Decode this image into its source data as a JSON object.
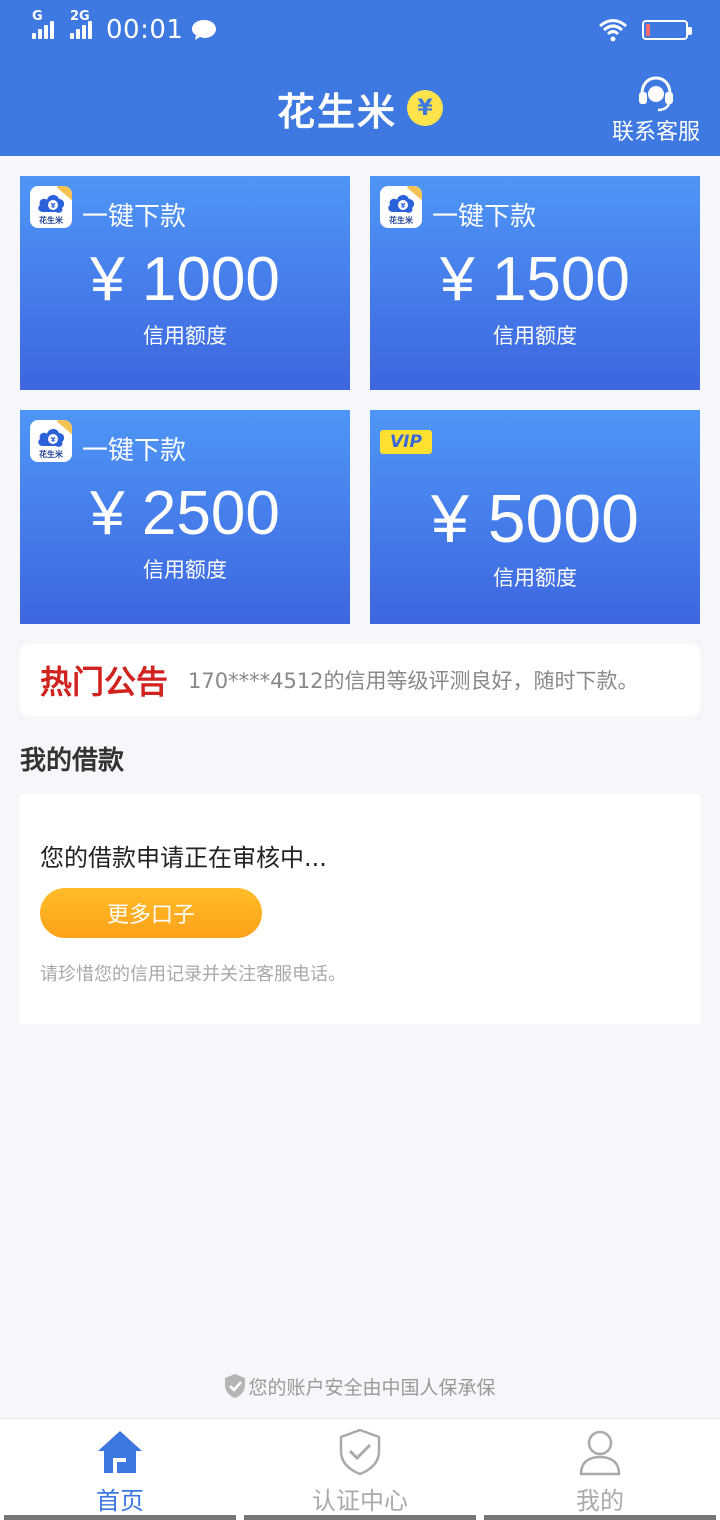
{
  "status_bar": {
    "signal1_label": "G",
    "signal2_label": "2G",
    "time": "00:01",
    "battery_level": "0",
    "battery_fill_fraction": 0.1
  },
  "header": {
    "title": "花生米",
    "coin_symbol": "¥",
    "service_label": "联系客服"
  },
  "cards": [
    {
      "tag": "一键下款",
      "amount": "¥ 1000",
      "sub": "信用额度",
      "logo_caption": "花生米"
    },
    {
      "tag": "一键下款",
      "amount": "¥ 1500",
      "sub": "信用额度",
      "logo_caption": "花生米"
    },
    {
      "tag": "一键下款",
      "amount": "¥ 2500",
      "sub": "信用额度",
      "logo_caption": "花生米"
    },
    {
      "badge": "VIP",
      "amount": "¥ 5000",
      "sub": "信用额度"
    }
  ],
  "notice": {
    "label": "热门公告",
    "text": "170****4512的信用等级评测良好，随时下款。"
  },
  "loan": {
    "section_title": "我的借款",
    "status": "您的借款申请正在审核中...",
    "button": "更多口子",
    "hint": "请珍惜您的信用记录并关注客服电话。"
  },
  "security": {
    "text": "您的账户安全由中国人保承保"
  },
  "nav": [
    {
      "label": "首页"
    },
    {
      "label": "认证中心"
    },
    {
      "label": "我的"
    }
  ],
  "colors": {
    "primary": "#3d79e0",
    "accent_orange": "#ffa11a",
    "notice_red": "#d0231f",
    "vip_yellow": "#ffe02e"
  }
}
